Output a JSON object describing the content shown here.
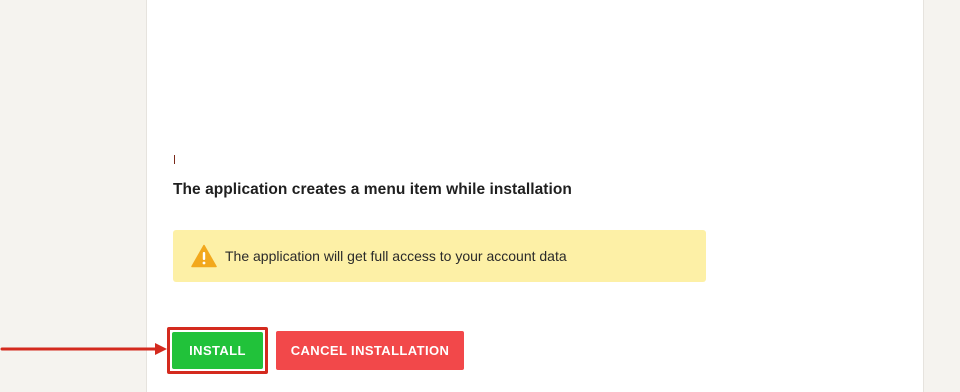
{
  "install_section": {
    "heading": "The application creates a menu item while installation",
    "warning": {
      "icon": "warning-triangle-icon",
      "text": "The application will get full access to your account data"
    },
    "buttons": {
      "install_label": "INSTALL",
      "cancel_label": "CANCEL INSTALLATION"
    }
  },
  "colors": {
    "install_button": "#21c23a",
    "cancel_button": "#f2484a",
    "warning_background": "#fdf0a6",
    "annotation_red": "#d42a1e"
  }
}
